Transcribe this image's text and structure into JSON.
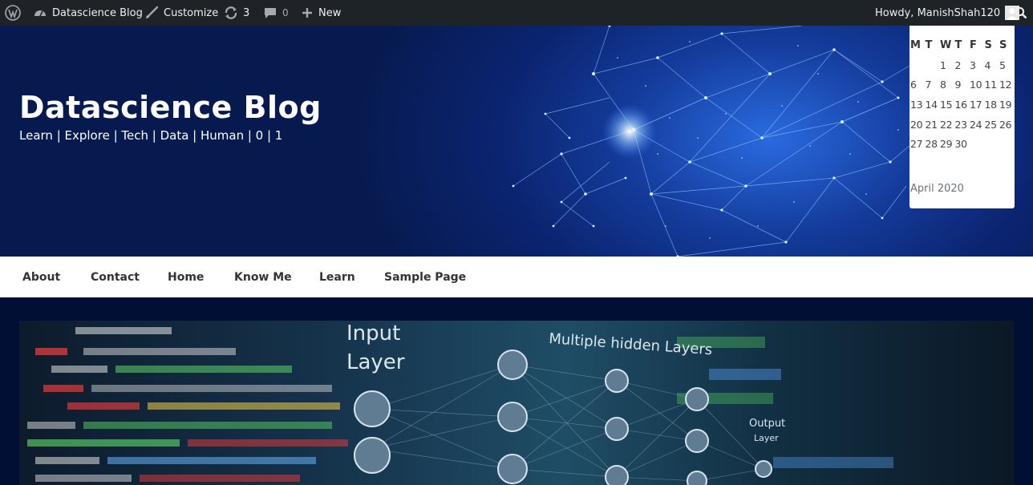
{
  "adminbar": {
    "site_name": "Datascience Blog",
    "customize": "Customize",
    "updates_count": "3",
    "comments_count": "0",
    "new": "New",
    "howdy": "Howdy, ManishShah120",
    "icons": [
      "wordpress-logo-icon",
      "dashboard-icon",
      "brush-icon",
      "updates-icon",
      "comment-icon",
      "plus-icon",
      "avatar-icon",
      "search-icon"
    ]
  },
  "header": {
    "title": "Datascience Blog",
    "tagline": "Learn | Explore | Tech | Data | Human | 0 | 1"
  },
  "calendar": {
    "days": [
      "M",
      "T",
      "W",
      "T",
      "F",
      "S",
      "S"
    ],
    "weeks": [
      [
        "",
        "",
        "1",
        "2",
        "3",
        "4",
        "5"
      ],
      [
        "6",
        "7",
        "8",
        "9",
        "10",
        "11",
        "12"
      ],
      [
        "13",
        "14",
        "15",
        "16",
        "17",
        "18",
        "19"
      ],
      [
        "20",
        "21",
        "22",
        "23",
        "24",
        "25",
        "26"
      ],
      [
        "27",
        "28",
        "29",
        "30",
        "",
        "",
        ""
      ]
    ],
    "caption": "April 2020"
  },
  "nav": {
    "items": [
      "About",
      "Contact",
      "Home",
      "Know Me",
      "Learn",
      "Sample Page"
    ]
  },
  "featured": {
    "labels": {
      "input": "Input",
      "layer": "Layer",
      "hidden": "Multiple hidden Layers",
      "output": "Output",
      "output_layer": "Layer"
    }
  },
  "colors": {
    "adminbar_bg": "#1d2327",
    "header_bg": "#0b2470",
    "nav_bg": "#ffffff",
    "content_bg": "#020f35"
  }
}
